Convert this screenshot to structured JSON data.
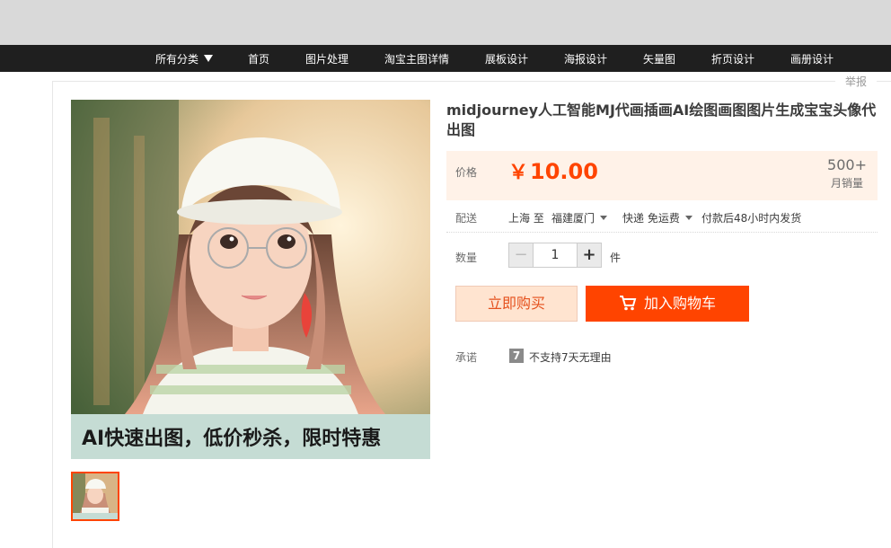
{
  "nav": {
    "items": [
      "所有分类",
      "首页",
      "图片处理",
      "淘宝主图详情",
      "展板设计",
      "海报设计",
      "矢量图",
      "折页设计",
      "画册设计"
    ]
  },
  "report_label": "举报",
  "product": {
    "title": "midjourney人工智能MJ代画插画AI绘图画图图片生成宝宝头像代出图",
    "image_banner": "AI快速出图，低价秒杀，限时特惠",
    "price_label": "价格",
    "currency": "￥",
    "price": "10.00",
    "sales_count": "500+",
    "sales_label": "月销量",
    "shipping_label": "配送",
    "ship_from": "上海 至",
    "ship_to": "福建厦门",
    "ship_method": "快递 免运费",
    "ship_note": "付款后48小时内发货",
    "qty_label": "数量",
    "qty_value": "1",
    "qty_unit": "件",
    "buy_now": "立即购买",
    "add_cart": "加入购物车",
    "promise_label": "承诺",
    "promise_icon": "7",
    "promise_text": "不支持7天无理由"
  },
  "colors": {
    "accent": "#ff4400",
    "nav_bg": "#1f1f1f",
    "price_bg": "#fff2e8"
  }
}
